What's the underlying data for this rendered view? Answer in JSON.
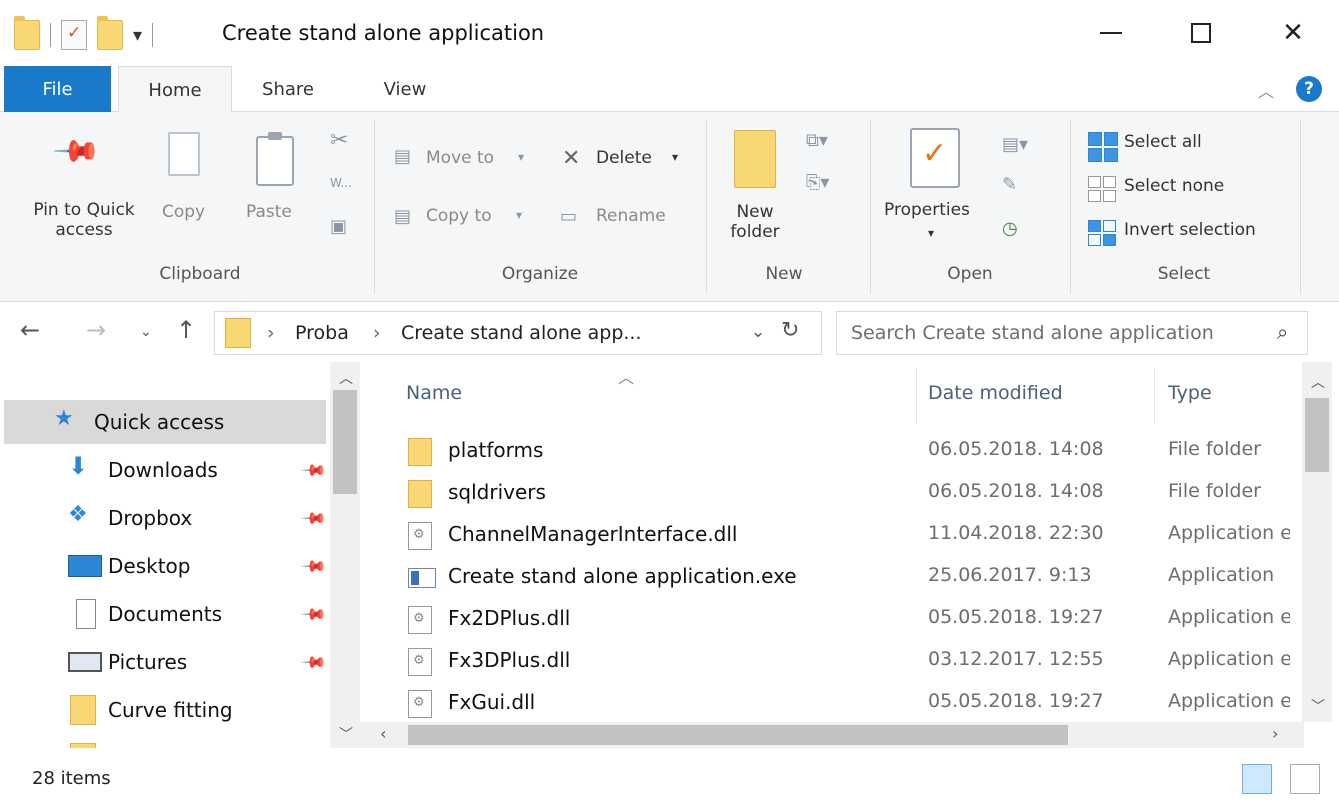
{
  "window": {
    "title": "Create stand alone application",
    "qat_dropdown": "▾"
  },
  "ribbon_tabs": {
    "file": "File",
    "home": "Home",
    "share": "Share",
    "view": "View"
  },
  "clipboard": {
    "pin_label": "Pin to Quick",
    "pin_label2": "access",
    "copy": "Copy",
    "paste": "Paste",
    "group": "Clipboard"
  },
  "organize": {
    "move_to": "Move to",
    "copy_to": "Copy to",
    "delete": "Delete",
    "rename": "Rename",
    "group": "Organize"
  },
  "new_group": {
    "new_folder": "New",
    "new_folder2": "folder",
    "group": "New"
  },
  "open_group": {
    "properties": "Properties",
    "group": "Open"
  },
  "select_group": {
    "select_all": "Select all",
    "select_none": "Select none",
    "invert_selection": "Invert selection",
    "group": "Select"
  },
  "address": {
    "crumbs": [
      "Proba",
      "Create stand alone app..."
    ],
    "search_placeholder": "Search Create stand alone application"
  },
  "nav_pane": {
    "items": [
      {
        "label": "Quick access",
        "icon": "star-icon",
        "selected": true
      },
      {
        "label": "Downloads",
        "icon": "download-icon",
        "pinned": true
      },
      {
        "label": "Dropbox",
        "icon": "dropbox-icon",
        "pinned": true
      },
      {
        "label": "Desktop",
        "icon": "desktop-icon",
        "pinned": true
      },
      {
        "label": "Documents",
        "icon": "documents-icon",
        "pinned": true
      },
      {
        "label": "Pictures",
        "icon": "pictures-icon",
        "pinned": true
      },
      {
        "label": "Curve fitting",
        "icon": "folder-icon"
      }
    ]
  },
  "file_list": {
    "columns": {
      "name": "Name",
      "date": "Date modified",
      "type": "Type"
    },
    "rows": [
      {
        "name": "platforms",
        "date": "06.05.2018. 14:08",
        "type": "File folder",
        "kind": "folder"
      },
      {
        "name": "sqldrivers",
        "date": "06.05.2018. 14:08",
        "type": "File folder",
        "kind": "folder"
      },
      {
        "name": "ChannelManagerInterface.dll",
        "date": "11.04.2018. 22:30",
        "type": "Application extension",
        "kind": "dll"
      },
      {
        "name": "Create stand alone application.exe",
        "date": "25.06.2017. 9:13",
        "type": "Application",
        "kind": "exe"
      },
      {
        "name": "Fx2DPlus.dll",
        "date": "05.05.2018. 19:27",
        "type": "Application extension",
        "kind": "dll"
      },
      {
        "name": "Fx3DPlus.dll",
        "date": "03.12.2017. 12:55",
        "type": "Application extension",
        "kind": "dll"
      },
      {
        "name": "FxGui.dll",
        "date": "05.05.2018. 19:27",
        "type": "Application extension",
        "kind": "dll"
      }
    ]
  },
  "status": {
    "item_count": "28 items"
  },
  "colors": {
    "file_tab": "#1979ca",
    "folder": "#f8d775",
    "selection": "#d9d9d9"
  }
}
